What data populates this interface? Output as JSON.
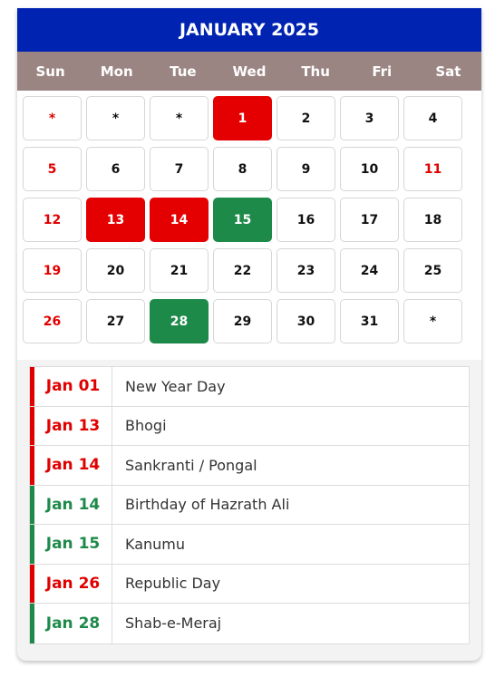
{
  "calendar": {
    "title": "JANUARY 2025",
    "weekdays": [
      "Sun",
      "Mon",
      "Tue",
      "Wed",
      "Thu",
      "Fri",
      "Sat"
    ],
    "weeks": [
      [
        "*",
        "*",
        "*",
        "1",
        "2",
        "3",
        "4"
      ],
      [
        "5",
        "6",
        "7",
        "8",
        "9",
        "10",
        "11"
      ],
      [
        "12",
        "13",
        "14",
        "15",
        "16",
        "17",
        "18"
      ],
      [
        "19",
        "20",
        "21",
        "22",
        "23",
        "24",
        "25"
      ],
      [
        "26",
        "27",
        "28",
        "29",
        "30",
        "31",
        "*"
      ]
    ]
  },
  "holidays": [
    {
      "date": "Jan 01",
      "name": "New Year Day"
    },
    {
      "date": "Jan 13",
      "name": "Bhogi"
    },
    {
      "date": "Jan 14",
      "name": "Sankranti / Pongal"
    },
    {
      "date": "Jan 14",
      "name": "Birthday of Hazrath Ali"
    },
    {
      "date": "Jan 15",
      "name": "Kanumu"
    },
    {
      "date": "Jan 26",
      "name": "Republic Day"
    },
    {
      "date": "Jan 28",
      "name": "Shab-e-Meraj"
    }
  ],
  "colors": {
    "header": "#0023b1",
    "weekday_bar": "#9a8582",
    "holiday_red": "#e40000",
    "holiday_green": "#1e8a4a"
  }
}
